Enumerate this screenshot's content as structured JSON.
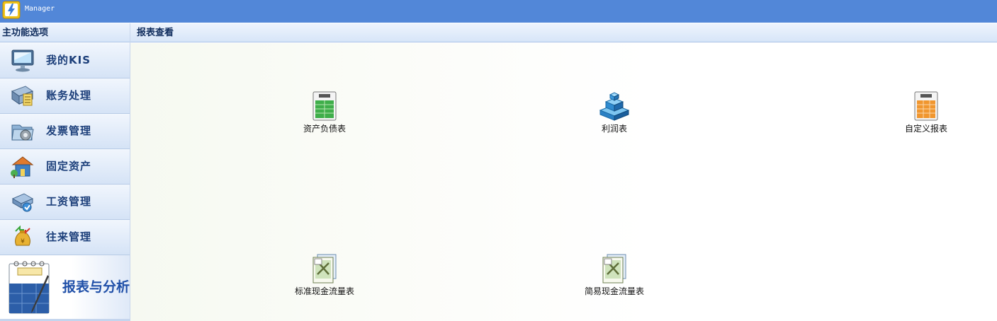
{
  "window": {
    "title": "Manager"
  },
  "sidebar": {
    "header": "主功能选项",
    "items": [
      {
        "label": "我的KIS",
        "icon": "monitor-icon"
      },
      {
        "label": "账务处理",
        "icon": "ledger-icon"
      },
      {
        "label": "发票管理",
        "icon": "invoice-folder-icon"
      },
      {
        "label": "固定资产",
        "icon": "house-icon"
      },
      {
        "label": "工资管理",
        "icon": "salary-icon"
      },
      {
        "label": "往来管理",
        "icon": "money-bag-icon"
      },
      {
        "label": "报表与分析",
        "icon": "notebook-icon",
        "active": true
      }
    ]
  },
  "main": {
    "header": "报表查看",
    "reports": [
      {
        "label": "资产负债表",
        "icon": "balance-sheet-icon"
      },
      {
        "label": "利润表",
        "icon": "profit-blocks-icon"
      },
      {
        "label": "自定义报表",
        "icon": "custom-report-icon"
      },
      {
        "label": "标准现金流量表",
        "icon": "cash-flow-icon"
      },
      {
        "label": "简易现金流量表",
        "icon": "cash-flow-icon"
      }
    ]
  },
  "colors": {
    "titlebar": "#5287d8",
    "accent": "#1f4fa8",
    "nav_text": "#1c3f7a"
  }
}
